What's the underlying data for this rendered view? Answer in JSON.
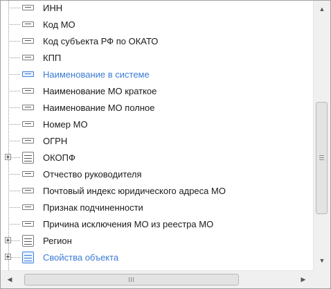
{
  "tree": {
    "items": [
      {
        "label": "ИНН",
        "type": "leaf"
      },
      {
        "label": "Код МО",
        "type": "leaf"
      },
      {
        "label": "Код субъекта РФ по ОКАТО",
        "type": "leaf"
      },
      {
        "label": "КПП",
        "type": "leaf"
      },
      {
        "label": "Наименование в системе",
        "type": "leaf",
        "highlight": true
      },
      {
        "label": "Наименование МО краткое",
        "type": "leaf"
      },
      {
        "label": "Наименование МО полное",
        "type": "leaf"
      },
      {
        "label": "Номер МО",
        "type": "leaf"
      },
      {
        "label": "ОГРН",
        "type": "leaf"
      },
      {
        "label": "ОКОПФ",
        "type": "group"
      },
      {
        "label": "Отчество руководителя",
        "type": "leaf"
      },
      {
        "label": "Почтовый индекс юридического адреса МО",
        "type": "leaf"
      },
      {
        "label": "Признак подчиненности",
        "type": "leaf"
      },
      {
        "label": "Причина исключения МО из реестра МО",
        "type": "leaf"
      },
      {
        "label": "Регион",
        "type": "group"
      },
      {
        "label": "Свойства объекта",
        "type": "group",
        "highlight": true
      }
    ]
  },
  "scrollbars": {
    "vertical": {
      "up": "▲",
      "down": "▼",
      "grip": "≡"
    },
    "horizontal": {
      "left": "◀",
      "right": "▶",
      "grip": "III"
    }
  },
  "colors": {
    "highlight": "#3a7bd5"
  }
}
